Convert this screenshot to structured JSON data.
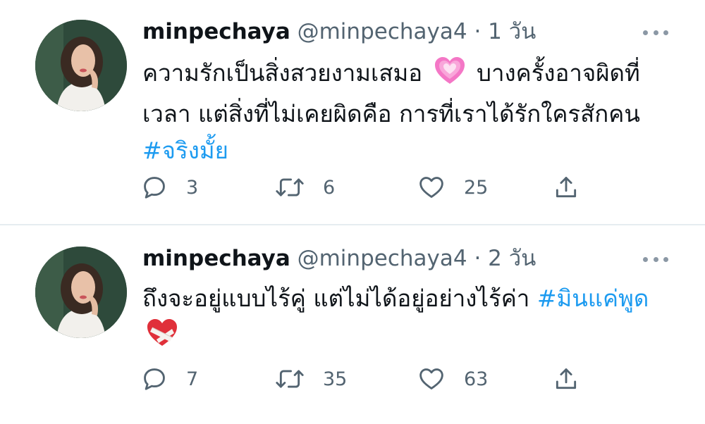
{
  "tweets": [
    {
      "display_name": "minpechaya",
      "handle": "@minpechaya4",
      "separator": "·",
      "time": "1 วัน",
      "text_before": "ความรักเป็นสิ่งสวยงามเสมอ",
      "emoji": "growing-heart",
      "text_after": "บางครั้งอาจผิดที่เวลา แต่สิ่งที่ไม่เคยผิดคือ การที่เราได้รักใครสักคน",
      "hashtag": "#จริงมั้ย",
      "replies": "3",
      "retweets": "6",
      "likes": "25"
    },
    {
      "display_name": "minpechaya",
      "handle": "@minpechaya4",
      "separator": "·",
      "time": "2 วัน",
      "text_before": "ถึงจะอยู่แบบไร้คู่ แต่ไม่ได้อยู่อย่างไร้ค่า",
      "hashtag": "#มินแค่พูด",
      "emoji": "mending-heart",
      "replies": "7",
      "retweets": "35",
      "likes": "63"
    }
  ],
  "colors": {
    "hashtag": "#1d9bf0",
    "secondary_text": "#536471",
    "divider": "#e6ecf0"
  },
  "icons": [
    "reply-icon",
    "retweet-icon",
    "like-icon",
    "share-icon",
    "more-options-icon"
  ]
}
